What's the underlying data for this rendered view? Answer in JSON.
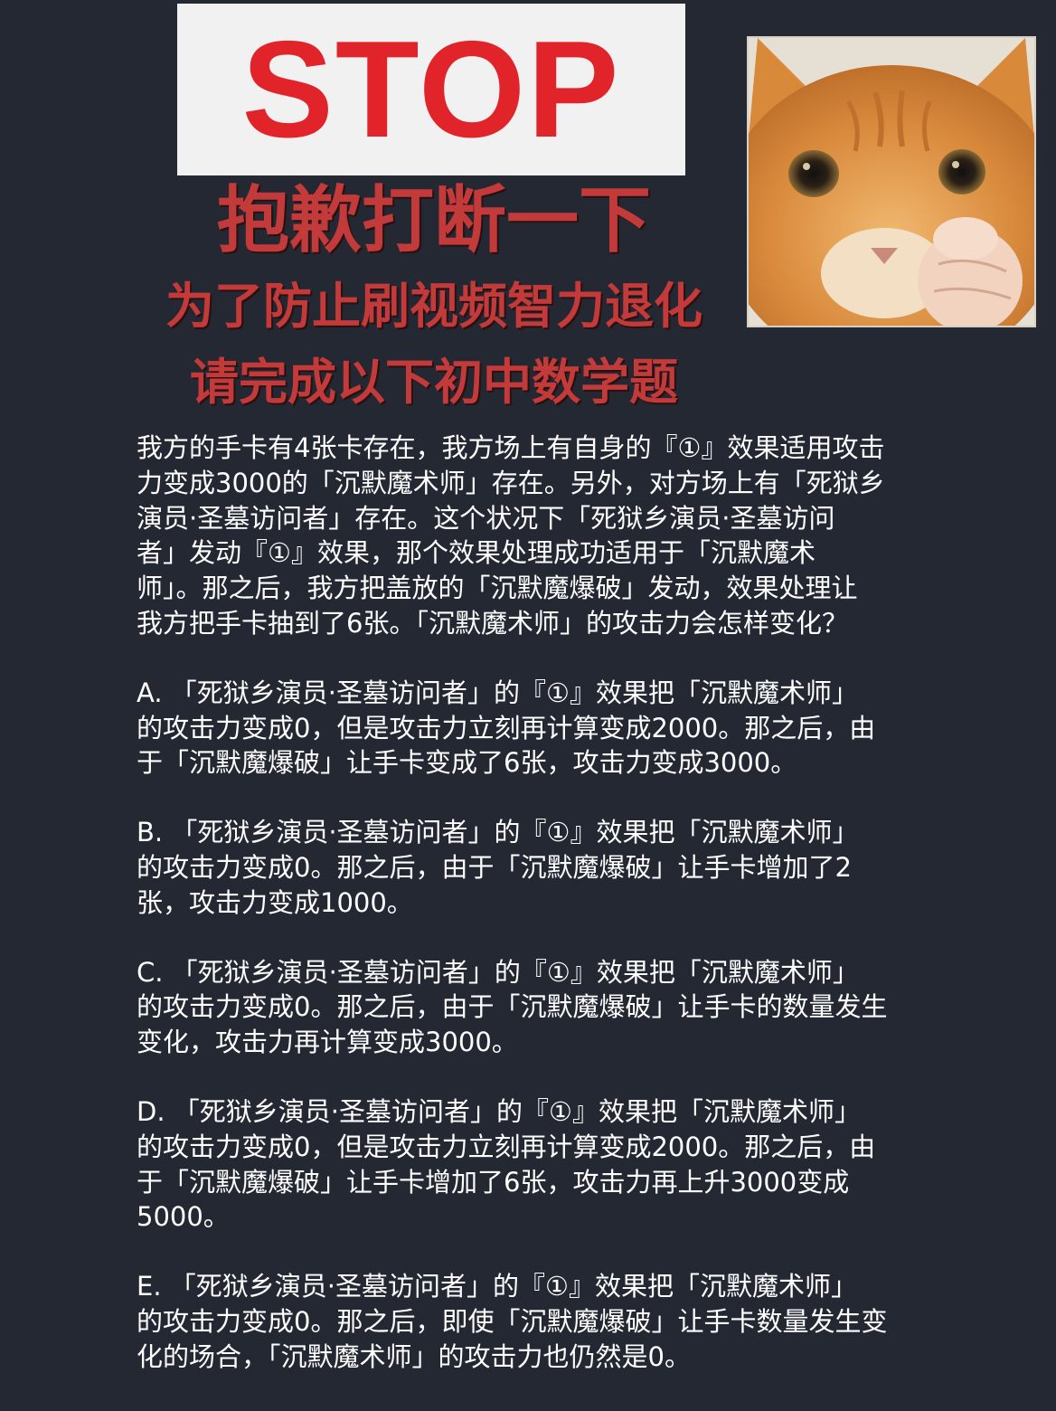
{
  "banner": {
    "stop": "STOP",
    "line1": "抱歉打断一下",
    "line2": "为了防止刷视频智力退化",
    "line3": "请完成以下初中数学题"
  },
  "question": "我方的手卡有4张卡存在，我方场上有自身的『①』效果适用攻击\n力变成3000的「沉默魔术师」存在。另外，对方场上有「死狱乡\n演员·圣墓访问者」存在。这个状况下「死狱乡演员·圣墓访问\n者」发动『①』效果，那个效果处理成功适用于「沉默魔术\n师」。那之后，我方把盖放的「沉默魔爆破」发动，效果处理让\n我方把手卡抽到了6张。「沉默魔术师」的攻击力会怎样变化？",
  "options": [
    "A. 「死狱乡演员·圣墓访问者」的『①』效果把「沉默魔术师」\n的攻击力变成0，但是攻击力立刻再计算变成2000。那之后，由\n于「沉默魔爆破」让手卡变成了6张，攻击力变成3000。",
    "B. 「死狱乡演员·圣墓访问者」的『①』效果把「沉默魔术师」\n的攻击力变成0。那之后，由于「沉默魔爆破」让手卡增加了2\n张，攻击力变成1000。",
    "C. 「死狱乡演员·圣墓访问者」的『①』效果把「沉默魔术师」\n的攻击力变成0。那之后，由于「沉默魔爆破」让手卡的数量发生\n变化，攻击力再计算变成3000。",
    "D. 「死狱乡演员·圣墓访问者」的『①』效果把「沉默魔术师」\n的攻击力变成0，但是攻击力立刻再计算变成2000。那之后，由\n于「沉默魔爆破」让手卡增加了6张，攻击力再上升3000变成\n5000。",
    "E. 「死狱乡演员·圣墓访问者」的『①』效果把「沉默魔术师」\n的攻击力变成0。那之后，即使「沉默魔爆破」让手卡数量发生变\n化的场合，「沉默魔术师」的攻击力也仍然是0。"
  ],
  "colors": {
    "background": "#232833",
    "stop_red": "#e0242a",
    "headline_red": "#c23a3a",
    "text": "#ffffff"
  }
}
